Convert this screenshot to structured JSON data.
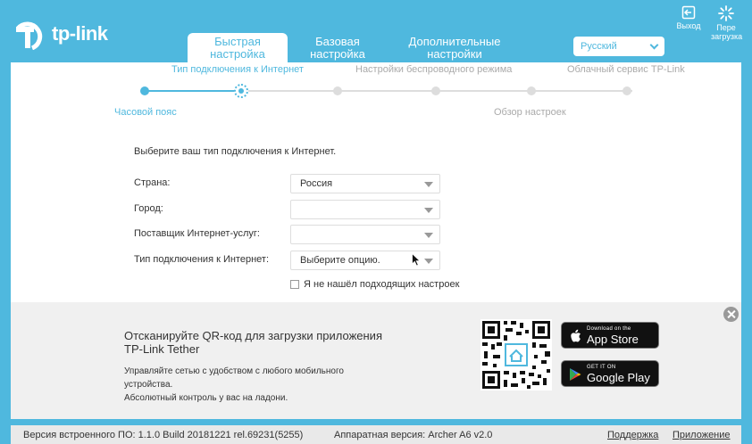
{
  "brand": {
    "logo_text": "tp-link",
    "accent": "#4fb8de"
  },
  "tabs": [
    {
      "label": "Быстрая настройка",
      "active": true
    },
    {
      "label": "Базовая настройка",
      "active": false
    },
    {
      "label": "Дополнительные настройки",
      "active": false
    }
  ],
  "language": {
    "selected": "Русский"
  },
  "header_buttons": {
    "logout": "Выход",
    "reboot": "Пере загрузка"
  },
  "progress": {
    "top_labels": [
      "Тип подключения к Интернет",
      "Настройки беспроводного режима",
      "Облачный сервис TP-Link"
    ],
    "bottom_labels": [
      "Часовой пояс",
      "Обзор настроек"
    ],
    "steps_total": 6,
    "steps_done": 1,
    "current_step": 2
  },
  "form": {
    "intro": "Выберите ваш тип подключения к Интернет.",
    "country_label": "Страна:",
    "country_value": "Россия",
    "city_label": "Город:",
    "city_value": "",
    "isp_label": "Поставщик Интернет-услуг:",
    "isp_value": "",
    "conn_label": "Тип подключения к Интернет:",
    "conn_value": "Выберите опцию.",
    "not_found_label": "Я не нашёл подходящих настроек"
  },
  "promo": {
    "title_line1": "Отсканируйте QR-код для загрузки приложения",
    "title_line2": "TP-Link Tether",
    "desc_line1": "Управляйте сетью с удобством с любого мобильного",
    "desc_line2": "устройства.",
    "desc_line3": "Абсолютный контроль у вас на ладони.",
    "appstore_small": "Download on the",
    "appstore_large": "App Store",
    "gplay_small": "GET IT ON",
    "gplay_large": "Google Play"
  },
  "footer": {
    "firmware": "Версия встроенного ПО: 1.1.0 Build 20181221 rel.69231(5255)",
    "hardware": "Аппаратная версия: Archer A6 v2.0",
    "support": "Поддержка",
    "app": "Приложение"
  }
}
